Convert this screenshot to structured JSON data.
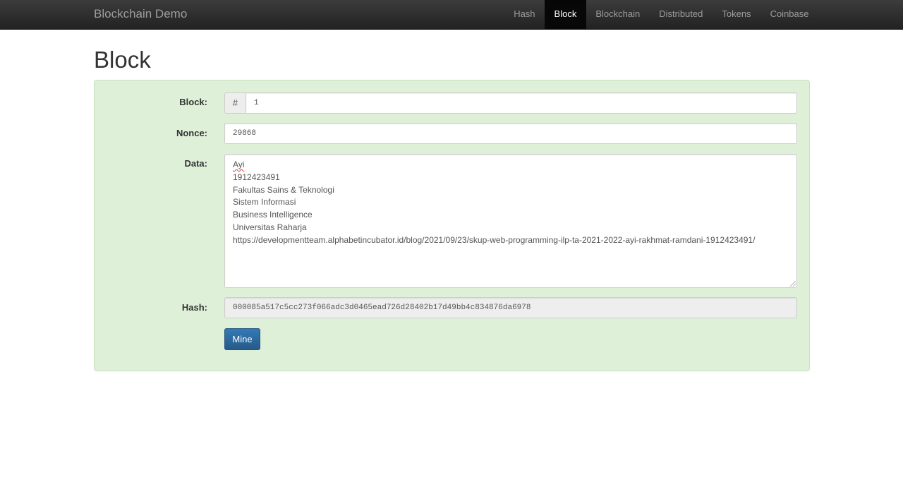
{
  "navbar": {
    "brand": "Blockchain Demo",
    "items": [
      {
        "label": "Hash",
        "active": false
      },
      {
        "label": "Block",
        "active": true
      },
      {
        "label": "Blockchain",
        "active": false
      },
      {
        "label": "Distributed",
        "active": false
      },
      {
        "label": "Tokens",
        "active": false
      },
      {
        "label": "Coinbase",
        "active": false
      }
    ]
  },
  "page": {
    "title": "Block"
  },
  "form": {
    "block_label": "Block:",
    "block_prefix": "#",
    "block_value": "1",
    "nonce_label": "Nonce:",
    "nonce_value": "29868",
    "data_label": "Data:",
    "data_lines": [
      "Ayi",
      "1912423491",
      "Fakultas Sains & Teknologi",
      "Sistem Informasi",
      "Business Intelligence",
      "Universitas Raharja",
      "https://developmentteam.alphabetincubator.id/blog/2021/09/23/skup-web-programming-ilp-ta-2021-2022-ayi-rakhmat-ramdani-1912423491/"
    ],
    "hash_label": "Hash:",
    "hash_value": "000085a517c5cc273f066adc3d0465ead726d28402b17d49bb4c834876da6978",
    "mine_label": "Mine"
  },
  "colors": {
    "well_bg": "#dff0d8",
    "primary": "#337ab7",
    "navbar_bg": "#222222"
  }
}
